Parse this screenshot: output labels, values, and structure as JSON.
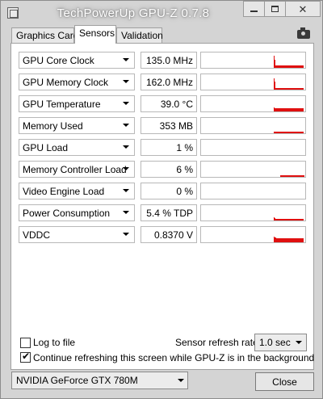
{
  "window": {
    "title": "TechPowerUp GPU-Z 0.7.8",
    "close_glyph": "✕",
    "min_icon": "minimize-icon",
    "max_icon": "maximize-icon"
  },
  "tabs": [
    {
      "label": "Graphics Card",
      "active": false
    },
    {
      "label": "Sensors",
      "active": true
    },
    {
      "label": "Validation",
      "active": false
    }
  ],
  "sensors": [
    {
      "name": "GPU Core Clock",
      "value": "135.0 MHz",
      "graph": [
        0,
        0,
        0,
        0,
        0,
        0,
        0,
        0,
        0,
        0,
        0,
        0,
        0,
        0,
        0,
        0,
        0,
        0,
        0,
        0,
        0,
        0,
        0,
        0,
        0,
        0,
        0,
        0,
        0,
        0,
        0,
        0,
        0,
        0,
        0,
        0,
        0,
        0,
        0,
        0,
        0,
        0,
        0,
        0,
        0,
        0,
        0,
        0,
        0,
        0,
        0,
        0,
        0,
        0,
        0,
        0,
        0,
        0,
        0,
        0,
        0,
        0,
        0,
        0,
        0,
        0,
        0,
        0,
        0,
        0,
        0,
        0,
        0,
        0,
        0,
        0,
        0,
        0,
        0,
        0,
        0,
        0,
        0,
        0,
        0,
        0,
        0,
        0,
        0,
        0,
        0.8,
        0.55,
        0.15,
        0.15,
        0.15,
        0.15,
        0.15,
        0.15,
        0.15,
        0.15,
        0.15,
        0.15,
        0.15,
        0.15,
        0.15,
        0.15,
        0.15,
        0.15,
        0.15,
        0.15,
        0.15,
        0.15,
        0.15,
        0.15,
        0.15,
        0.15,
        0.15,
        0.15,
        0.15,
        0.15,
        0.15,
        0.15,
        0.15,
        0.15,
        0.15,
        0.15,
        0.15
      ]
    },
    {
      "name": "GPU Memory Clock",
      "value": "162.0 MHz",
      "graph": [
        0,
        0,
        0,
        0,
        0,
        0,
        0,
        0,
        0,
        0,
        0,
        0,
        0,
        0,
        0,
        0,
        0,
        0,
        0,
        0,
        0,
        0,
        0,
        0,
        0,
        0,
        0,
        0,
        0,
        0,
        0,
        0,
        0,
        0,
        0,
        0,
        0,
        0,
        0,
        0,
        0,
        0,
        0,
        0,
        0,
        0,
        0,
        0,
        0,
        0,
        0,
        0,
        0,
        0,
        0,
        0,
        0,
        0,
        0,
        0,
        0,
        0,
        0,
        0,
        0,
        0,
        0,
        0,
        0,
        0,
        0,
        0,
        0,
        0,
        0,
        0,
        0,
        0,
        0,
        0,
        0,
        0,
        0,
        0,
        0,
        0,
        0,
        0,
        0,
        0,
        0.75,
        0.5,
        0.12,
        0.12,
        0.12,
        0.12,
        0.12,
        0.12,
        0.12,
        0.12,
        0.12,
        0.12,
        0.12,
        0.12,
        0.12,
        0.12,
        0.12,
        0.12,
        0.12,
        0.12,
        0.12,
        0.12,
        0.12,
        0.12,
        0.12,
        0.12,
        0.12,
        0.12,
        0.12,
        0.12,
        0.12,
        0.12,
        0.12,
        0.12,
        0.12,
        0.12,
        0.12
      ]
    },
    {
      "name": "GPU Temperature",
      "value": "39.0 °C",
      "graph": [
        0,
        0,
        0,
        0,
        0,
        0,
        0,
        0,
        0,
        0,
        0,
        0,
        0,
        0,
        0,
        0,
        0,
        0,
        0,
        0,
        0,
        0,
        0,
        0,
        0,
        0,
        0,
        0,
        0,
        0,
        0,
        0,
        0,
        0,
        0,
        0,
        0,
        0,
        0,
        0,
        0,
        0,
        0,
        0,
        0,
        0,
        0,
        0,
        0,
        0,
        0,
        0,
        0,
        0,
        0,
        0,
        0,
        0,
        0,
        0,
        0,
        0,
        0,
        0,
        0,
        0,
        0,
        0,
        0,
        0,
        0,
        0,
        0,
        0,
        0,
        0,
        0,
        0,
        0,
        0,
        0,
        0,
        0,
        0,
        0,
        0,
        0,
        0,
        0,
        0,
        0.25,
        0.22,
        0.2,
        0.2,
        0.2,
        0.2,
        0.2,
        0.2,
        0.2,
        0.2,
        0.2,
        0.2,
        0.2,
        0.2,
        0.2,
        0.2,
        0.2,
        0.2,
        0.2,
        0.2,
        0.2,
        0.2,
        0.2,
        0.2,
        0.2,
        0.2,
        0.2,
        0.2,
        0.2,
        0.2,
        0.2,
        0.2,
        0.2,
        0.2,
        0.2,
        0.2,
        0.2
      ]
    },
    {
      "name": "Memory Used",
      "value": "353 MB",
      "graph": [
        0,
        0,
        0,
        0,
        0,
        0,
        0,
        0,
        0,
        0,
        0,
        0,
        0,
        0,
        0,
        0,
        0,
        0,
        0,
        0,
        0,
        0,
        0,
        0,
        0,
        0,
        0,
        0,
        0,
        0,
        0,
        0,
        0,
        0,
        0,
        0,
        0,
        0,
        0,
        0,
        0,
        0,
        0,
        0,
        0,
        0,
        0,
        0,
        0,
        0,
        0,
        0,
        0,
        0,
        0,
        0,
        0,
        0,
        0,
        0,
        0,
        0,
        0,
        0,
        0,
        0,
        0,
        0,
        0,
        0,
        0,
        0,
        0,
        0,
        0,
        0,
        0,
        0,
        0,
        0,
        0,
        0,
        0,
        0,
        0,
        0,
        0,
        0,
        0,
        0,
        0.1,
        0.1,
        0.1,
        0.1,
        0.1,
        0.1,
        0.1,
        0.1,
        0.1,
        0.1,
        0.1,
        0.1,
        0.1,
        0.1,
        0.1,
        0.1,
        0.1,
        0.1,
        0.1,
        0.1,
        0.1,
        0.1,
        0.1,
        0.1,
        0.1,
        0.1,
        0.1,
        0.1,
        0.1,
        0.1,
        0.1,
        0.1,
        0.1,
        0.1,
        0.1,
        0.1,
        0.1
      ]
    },
    {
      "name": "GPU Load",
      "value": "1 %",
      "graph": []
    },
    {
      "name": "Memory Controller Load",
      "value": "6 %",
      "graph": [
        0,
        0,
        0,
        0,
        0,
        0,
        0,
        0,
        0,
        0,
        0,
        0,
        0,
        0,
        0,
        0,
        0,
        0,
        0,
        0,
        0,
        0,
        0,
        0,
        0,
        0,
        0,
        0,
        0,
        0,
        0,
        0,
        0,
        0,
        0,
        0,
        0,
        0,
        0,
        0,
        0,
        0,
        0,
        0,
        0,
        0,
        0,
        0,
        0,
        0,
        0,
        0,
        0,
        0,
        0,
        0,
        0,
        0,
        0,
        0,
        0,
        0,
        0,
        0,
        0,
        0,
        0,
        0,
        0,
        0,
        0,
        0,
        0,
        0,
        0,
        0,
        0,
        0,
        0,
        0,
        0,
        0,
        0,
        0,
        0,
        0,
        0,
        0,
        0,
        0,
        0,
        0,
        0,
        0,
        0,
        0,
        0,
        0,
        0.08,
        0.08,
        0.08,
        0.08,
        0.08,
        0.08,
        0.08,
        0.08,
        0.08,
        0.08,
        0.08,
        0.08,
        0.08,
        0.08,
        0.08,
        0.08,
        0.08,
        0.08,
        0.08,
        0.08,
        0.08,
        0.08,
        0.08,
        0.08,
        0.08,
        0.08,
        0.08,
        0.08,
        0.08,
        0.08
      ]
    },
    {
      "name": "Video Engine Load",
      "value": "0 %",
      "graph": []
    },
    {
      "name": "Power Consumption",
      "value": "5.4 % TDP",
      "graph": [
        0,
        0,
        0,
        0,
        0,
        0,
        0,
        0,
        0,
        0,
        0,
        0,
        0,
        0,
        0,
        0,
        0,
        0,
        0,
        0,
        0,
        0,
        0,
        0,
        0,
        0,
        0,
        0,
        0,
        0,
        0,
        0,
        0,
        0,
        0,
        0,
        0,
        0,
        0,
        0,
        0,
        0,
        0,
        0,
        0,
        0,
        0,
        0,
        0,
        0,
        0,
        0,
        0,
        0,
        0,
        0,
        0,
        0,
        0,
        0,
        0,
        0,
        0,
        0,
        0,
        0,
        0,
        0,
        0,
        0,
        0,
        0,
        0,
        0,
        0,
        0,
        0,
        0,
        0,
        0,
        0,
        0,
        0,
        0,
        0,
        0,
        0,
        0,
        0,
        0,
        0.2,
        0.15,
        0.12,
        0.12,
        0.1,
        0.1,
        0.1,
        0.1,
        0.1,
        0.1,
        0.1,
        0.1,
        0.1,
        0.1,
        0.1,
        0.1,
        0.1,
        0.1,
        0.1,
        0.1,
        0.1,
        0.1,
        0.1,
        0.1,
        0.1,
        0.1,
        0.1,
        0.1,
        0.1,
        0.1,
        0.1,
        0.1,
        0.1,
        0.1,
        0.1,
        0.1,
        0.1
      ]
    },
    {
      "name": "VDDC",
      "value": "0.8370 V",
      "graph": [
        0,
        0,
        0,
        0,
        0,
        0,
        0,
        0,
        0,
        0,
        0,
        0,
        0,
        0,
        0,
        0,
        0,
        0,
        0,
        0,
        0,
        0,
        0,
        0,
        0,
        0,
        0,
        0,
        0,
        0,
        0,
        0,
        0,
        0,
        0,
        0,
        0,
        0,
        0,
        0,
        0,
        0,
        0,
        0,
        0,
        0,
        0,
        0,
        0,
        0,
        0,
        0,
        0,
        0,
        0,
        0,
        0,
        0,
        0,
        0,
        0,
        0,
        0,
        0,
        0,
        0,
        0,
        0,
        0,
        0,
        0,
        0,
        0,
        0,
        0,
        0,
        0,
        0,
        0,
        0,
        0,
        0,
        0,
        0,
        0,
        0,
        0,
        0,
        0,
        0,
        0.35,
        0.3,
        0.3,
        0.28,
        0.28,
        0.28,
        0.28,
        0.28,
        0.28,
        0.28,
        0.28,
        0.28,
        0.28,
        0.28,
        0.28,
        0.28,
        0.28,
        0.28,
        0.28,
        0.28,
        0.28,
        0.28,
        0.28,
        0.28,
        0.28,
        0.28,
        0.28,
        0.28,
        0.28,
        0.28,
        0.28,
        0.28,
        0.28,
        0.28,
        0.28,
        0.28,
        0.28
      ]
    }
  ],
  "graph_color": "#e01010",
  "options": {
    "log_label": "Log to file",
    "log_checked": false,
    "continue_label": "Continue refreshing this screen while GPU-Z is in the background",
    "continue_checked": true,
    "refresh_label": "Sensor refresh rate:",
    "refresh_value": "1.0 sec"
  },
  "footer": {
    "gpu_select_value": "NVIDIA GeForce GTX 780M",
    "close_label": "Close"
  }
}
